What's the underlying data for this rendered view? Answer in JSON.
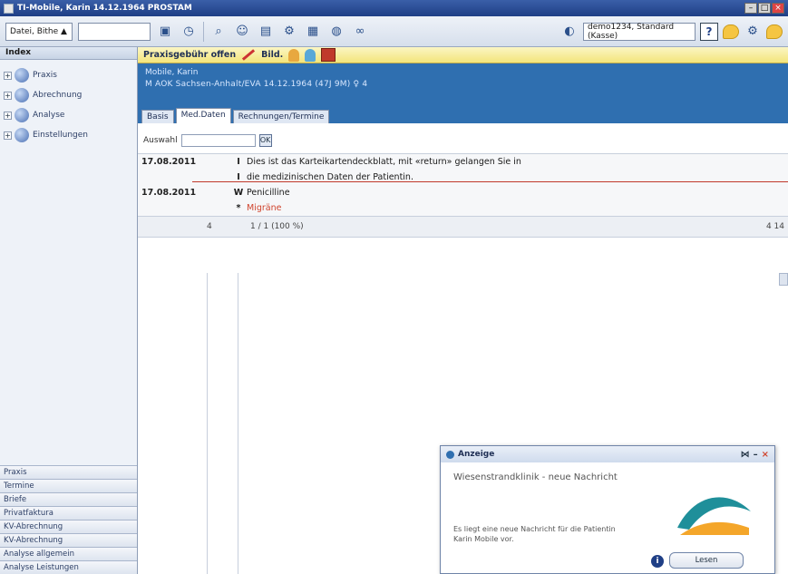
{
  "window": {
    "title": "TI-Mobile, Karin 14.12.1964 PROSTAM"
  },
  "toolbar": {
    "date_combo": "Datei, Bithe ▲",
    "field_value": "",
    "user_combo": "demo1234, Standard (Kasse)",
    "help_label": "?"
  },
  "sidebar": {
    "header": "Index",
    "tree": [
      {
        "label": "Praxis",
        "expander": "+"
      },
      {
        "label": "Abrechnung",
        "expander": "+"
      },
      {
        "label": "Analyse",
        "expander": "+"
      },
      {
        "label": "Einstellungen",
        "expander": "+"
      }
    ],
    "nav_buttons": [
      "Praxis",
      "Termine",
      "Briefe",
      "Privatfaktura",
      "KV-Abrechnung",
      "KV-Abrechnung",
      "Analyse allgemein",
      "Analyse Leistungen"
    ]
  },
  "alert_bar": {
    "label": "Praxisgebühr offen",
    "label2": "Bild."
  },
  "patient": {
    "name": "Mobile, Karin",
    "info": "M AOK Sachsen-Anhalt/EVA 14.12.1964 (47J 9M) ♀ 4"
  },
  "tabs": [
    {
      "label": "Basis",
      "active": false
    },
    {
      "label": "Med.Daten",
      "active": true
    },
    {
      "label": "Rechnungen/Termine",
      "active": false
    }
  ],
  "search": {
    "label": "Auswahl",
    "value": "",
    "go": "OK"
  },
  "entries": [
    {
      "date": "17.08.2011",
      "type": "I",
      "text": "Dies ist das Karteikartendeckblatt, mit «return» gelangen Sie in"
    },
    {
      "date": "",
      "type": "I",
      "text": "die medizinischen Daten der Patientin."
    },
    {
      "date": "17.08.2011",
      "type": "W",
      "text": "Penicilline"
    },
    {
      "date": "",
      "type": "*",
      "text": "Migräne",
      "red": true
    }
  ],
  "summary": {
    "col1": "4",
    "col2": "1 / 1 (100 %)",
    "col3": "4 14"
  },
  "popup": {
    "title": "Anzeige",
    "heading": "Wiesenstrandklinik - neue Nachricht",
    "message": "Es liegt eine neue Nachricht für die Patientin Karin Mobile vor.",
    "info_icon": "i",
    "button": "Lesen",
    "logo_colors": [
      "#1f8f9a",
      "#f4a62a"
    ]
  }
}
